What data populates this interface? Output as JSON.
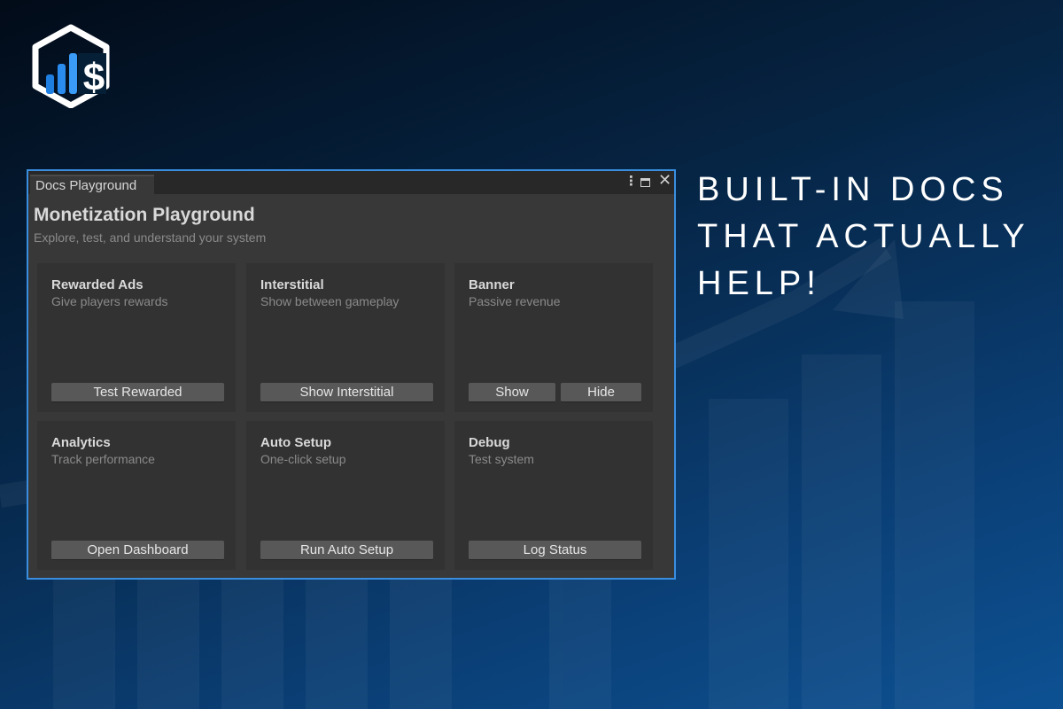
{
  "colors": {
    "background_top": "#020b18",
    "background_bottom": "#0d5193",
    "window_border": "#3a8ee0",
    "window_background": "#383838",
    "card_background": "#323232",
    "button_background": "#585858",
    "logo_accent": "#2b8cf0"
  },
  "logo": {
    "icon": "hexagon-chart-dollar-icon"
  },
  "window": {
    "tab_label": "Docs Playground",
    "controls": {
      "menu_icon": "vertical-dots-icon",
      "maximize_icon": "maximize-icon",
      "close_icon": "close-icon"
    },
    "title": "Monetization Playground",
    "subtitle": "Explore, test, and understand your system",
    "cards": [
      {
        "title": "Rewarded Ads",
        "desc": "Give players rewards",
        "buttons": [
          "Test Rewarded"
        ]
      },
      {
        "title": "Interstitial",
        "desc": "Show between gameplay",
        "buttons": [
          "Show Interstitial"
        ]
      },
      {
        "title": "Banner",
        "desc": "Passive revenue",
        "buttons": [
          "Show",
          "Hide"
        ]
      },
      {
        "title": "Analytics",
        "desc": "Track performance",
        "buttons": [
          "Open Dashboard"
        ]
      },
      {
        "title": "Auto Setup",
        "desc": "One-click setup",
        "buttons": [
          "Run Auto Setup"
        ]
      },
      {
        "title": "Debug",
        "desc": "Test system",
        "buttons": [
          "Log Status"
        ]
      }
    ]
  },
  "headline": {
    "lines": [
      "BUILT-IN DOCS",
      "THAT ACTUALLY",
      "HELP!"
    ]
  }
}
